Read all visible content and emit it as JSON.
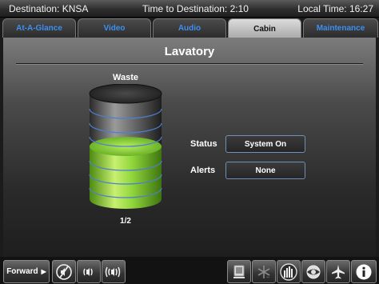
{
  "status_bar": {
    "destination": "Destination: KNSA",
    "time_to_destination": "Time to Destination: 2:10",
    "local_time": "Local Time: 16:27"
  },
  "tabs": [
    {
      "label": "At-A-Glance",
      "active": false
    },
    {
      "label": "Video",
      "active": false
    },
    {
      "label": "Audio",
      "active": false
    },
    {
      "label": "Cabin",
      "active": true
    },
    {
      "label": "Maintenance",
      "active": false
    }
  ],
  "page": {
    "title": "Lavatory",
    "tank_label": "Waste",
    "tank_fill_fraction": 0.5,
    "tank_fill_text": "1/2",
    "status_label": "Status",
    "status_value": "System On",
    "alerts_label": "Alerts",
    "alerts_value": "None"
  },
  "bottom_bar": {
    "forward_label": "Forward",
    "icons": [
      "mute-icon",
      "volume-down-icon",
      "volume-up-icon",
      "monitor-icon",
      "climate-icon",
      "lighting-icon",
      "window-shade-icon",
      "airplane-icon",
      "info-icon"
    ]
  },
  "colors": {
    "accent_blue": "#3f8ff0",
    "tank_green": "#8fd43a",
    "tank_gray": "#6d6d6d"
  }
}
